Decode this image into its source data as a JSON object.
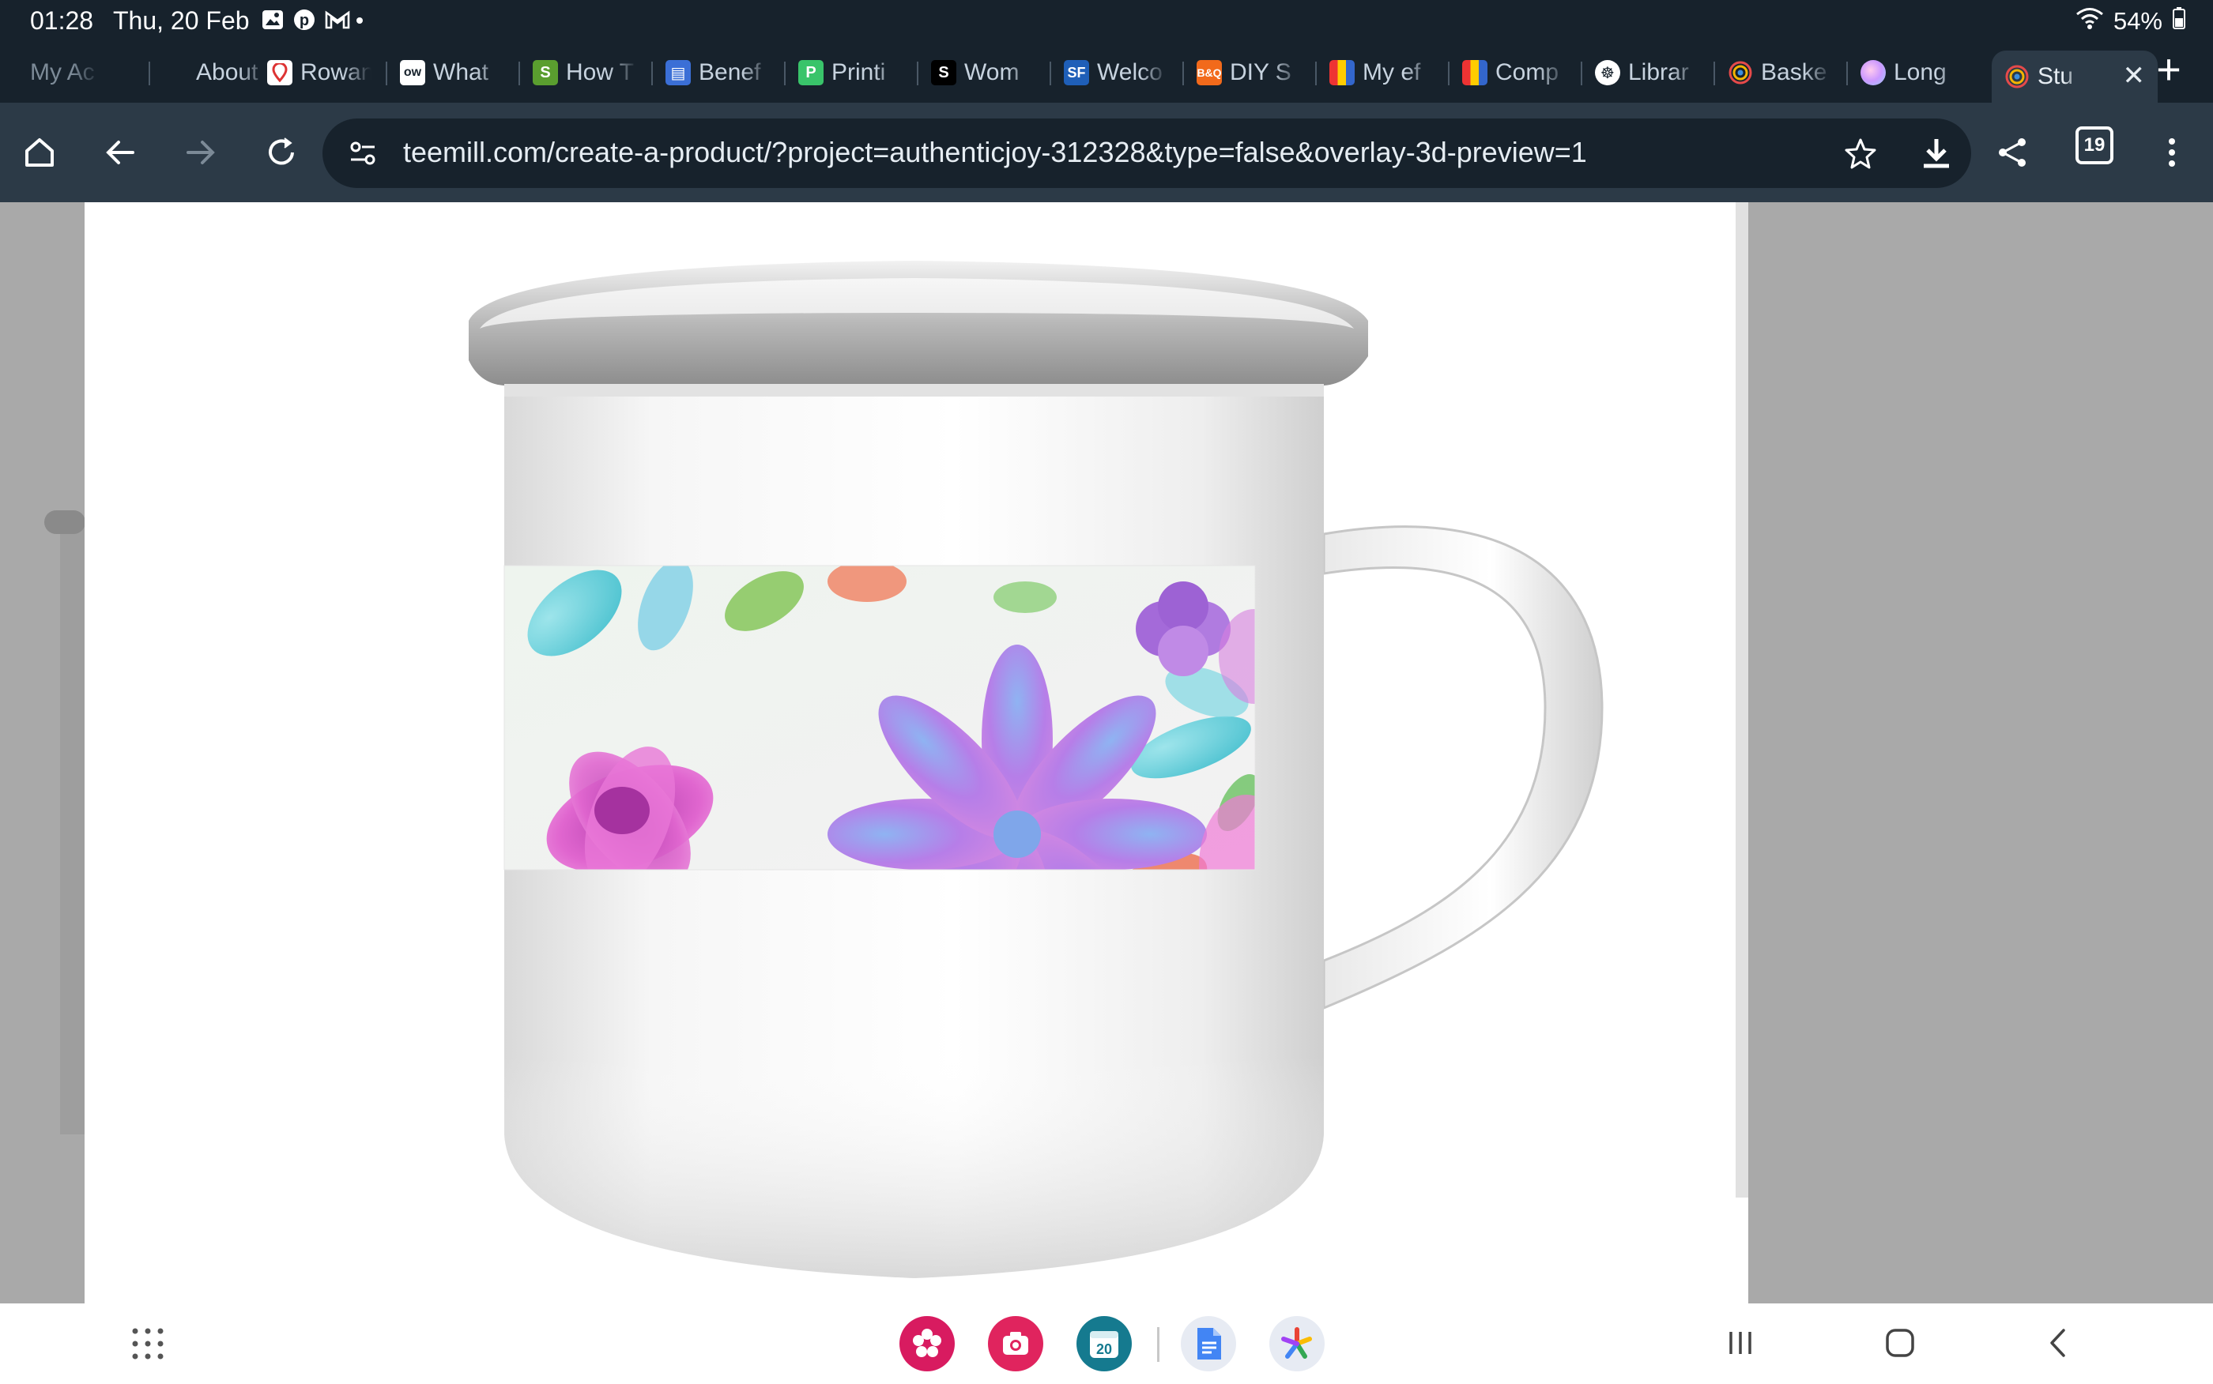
{
  "status_bar": {
    "time": "01:28",
    "date": "Thu, 20 Feb",
    "notification_icons": [
      "gallery-icon",
      "pinterest-icon",
      "gmail-icon",
      "more-dot-icon"
    ],
    "battery": "54%",
    "wifi": "wifi-icon"
  },
  "tabs": [
    {
      "label": "My Ac",
      "icon": "none"
    },
    {
      "label": "About",
      "icon": "none"
    },
    {
      "label": "Rowan",
      "icon": "rowan-favicon"
    },
    {
      "label": "What",
      "icon": "ow-favicon"
    },
    {
      "label": "How T",
      "icon": "shopify-favicon"
    },
    {
      "label": "Benef",
      "icon": "sheets-favicon"
    },
    {
      "label": "Printi",
      "icon": "printify-favicon"
    },
    {
      "label": "Wom",
      "icon": "s-favicon"
    },
    {
      "label": "Welco",
      "icon": "sf-favicon"
    },
    {
      "label": "DIY S",
      "icon": "bq-favicon"
    },
    {
      "label": "My ef",
      "icon": "bars-favicon"
    },
    {
      "label": "Comp",
      "icon": "bars-favicon"
    },
    {
      "label": "Librar",
      "icon": "library-favicon"
    },
    {
      "label": "Baske",
      "icon": "teemill-favicon"
    },
    {
      "label": "Long",
      "icon": "circle-favicon"
    },
    {
      "label": "Stu",
      "icon": "teemill-favicon",
      "active": true
    }
  ],
  "toolbar": {
    "url": "teemill.com/create-a-product/?project=authenticjoy-312328&type=false&overlay-3d-preview=1",
    "tab_count": "19"
  },
  "preview": {
    "product": "enamel-mug",
    "print_pattern": "watercolor-floral"
  },
  "colors": {
    "statusbar_bg": "#17222c",
    "toolbar_bg": "#2c3a47",
    "page_bg": "#a9a9a9",
    "card_bg": "#ffffff"
  },
  "dock": {
    "apps": [
      "blossom-app-icon",
      "camera-app-icon",
      "calendar-app-icon",
      "docs-app-icon",
      "pinwheel-app-icon"
    ],
    "calendar_day": "20"
  }
}
